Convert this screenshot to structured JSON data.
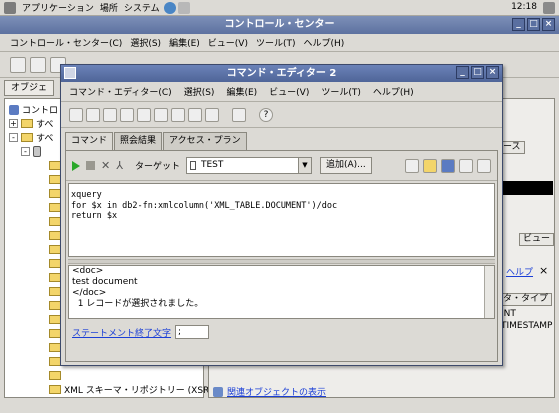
{
  "panel": {
    "applications": "アプリケーション",
    "places": "場所",
    "system": "システム",
    "clock": "12:18"
  },
  "main_window": {
    "title": "コントロール・センター",
    "menu": [
      "コントロール・センター(C)",
      "選択(S)",
      "編集(E)",
      "ビュー(V)",
      "ツール(T)",
      "ヘルプ(H)"
    ],
    "object_tab": "オブジェ",
    "tree": [
      "コントロ",
      "すべ",
      "すべ",
      "XML スキーマ・リポジトリー (XSR)"
    ],
    "right_pane": {
      "column_header": "ース",
      "view_button": "ビュー",
      "help_link": "ヘルプ",
      "type_header": "タ・タイプ",
      "row_int": "INT",
      "row_timestamp": "TIMESTAMP",
      "related_objects_link": "関連オブジェクトの表示"
    }
  },
  "dialog": {
    "title": "コマンド・エディター 2",
    "menu": [
      "コマンド・エディター(C)",
      "選択(S)",
      "編集(E)",
      "ビュー(V)",
      "ツール(T)",
      "ヘルプ(H)"
    ],
    "tabs": [
      "コマンド",
      "照会結果",
      "アクセス・プラン"
    ],
    "target_label": "ターゲット",
    "target_value": "TEST",
    "add_button": "追加(A)...",
    "editor_lines": [
      "xquery",
      "for $x in db2-fn:xmlcolumn('XML_TABLE.DOCUMENT')/doc",
      "return $x"
    ],
    "result_lines": [
      "<doc>",
      "test document",
      "</doc>",
      "",
      "  1 レコードが選択されました。"
    ],
    "stmt_term_label": "ステートメント終了文字",
    "stmt_term_value": ";"
  }
}
